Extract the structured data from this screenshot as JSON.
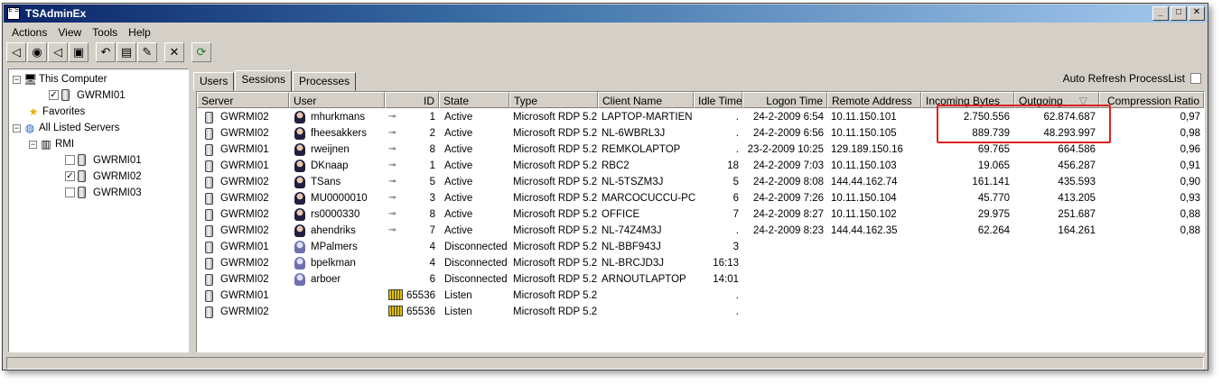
{
  "window": {
    "title": "TSAdminEx",
    "icon_text": "E S",
    "controls": {
      "minimize": "_",
      "maximize": "□",
      "close": "✕"
    }
  },
  "menu": [
    "Actions",
    "View",
    "Tools",
    "Help"
  ],
  "toolbar": [
    {
      "name": "connect-icon",
      "glyph": "◁"
    },
    {
      "name": "send-message-icon",
      "glyph": "◉"
    },
    {
      "name": "disconnect-icon",
      "glyph": "◁"
    },
    {
      "name": "remote-control-icon",
      "glyph": "▣"
    },
    {
      "name": "logoff-icon",
      "glyph": "↶"
    },
    {
      "name": "reset-icon",
      "glyph": "▤"
    },
    {
      "name": "status-icon",
      "glyph": "✎"
    },
    {
      "name": "delete-icon",
      "glyph": "✕"
    },
    {
      "name": "refresh-icon",
      "glyph": "⟳"
    }
  ],
  "tree": {
    "this_computer": "This Computer",
    "this_computer_server": "GWRMI01",
    "favorites": "Favorites",
    "all_listed": "All Listed Servers",
    "domain": "RMI",
    "servers": [
      "GWRMI01",
      "GWRMI02",
      "GWRMI03"
    ]
  },
  "tabs": [
    "Users",
    "Sessions",
    "Processes"
  ],
  "active_tab": "Sessions",
  "auto_refresh_label": "Auto Refresh ProcessList",
  "columns": [
    "Server",
    "User",
    "ID",
    "State",
    "Type",
    "Client Name",
    "Idle Time",
    "Logon Time",
    "Remote Address",
    "Incoming Bytes",
    "Outgoing",
    "Compression Ratio"
  ],
  "rows": [
    {
      "server": "GWRMI02",
      "user": "mhurkmans",
      "kind": "active",
      "id": "1",
      "state": "Active",
      "type": "Microsoft RDP 5.2",
      "client": "LAPTOP-MARTIEN",
      "idle": ".",
      "logon": "24-2-2009 6:54",
      "remote": "10.11.150.101",
      "in": "2.750.556",
      "out": "62.874.687",
      "ratio": "0,97"
    },
    {
      "server": "GWRMI02",
      "user": "fheesakkers",
      "kind": "active",
      "id": "2",
      "state": "Active",
      "type": "Microsoft RDP 5.2",
      "client": "NL-6WBRL3J",
      "idle": ".",
      "logon": "24-2-2009 6:56",
      "remote": "10.11.150.105",
      "in": "889.739",
      "out": "48.293.997",
      "ratio": "0,98"
    },
    {
      "server": "GWRMI01",
      "user": "rweijnen",
      "kind": "active",
      "id": "8",
      "state": "Active",
      "type": "Microsoft RDP 5.2",
      "client": "REMKOLAPTOP",
      "idle": ".",
      "logon": "23-2-2009 10:25",
      "remote": "129.189.150.16",
      "in": "69.765",
      "out": "664.586",
      "ratio": "0,96"
    },
    {
      "server": "GWRMI01",
      "user": "DKnaap",
      "kind": "active",
      "id": "1",
      "state": "Active",
      "type": "Microsoft RDP 5.2",
      "client": "RBC2",
      "idle": "18",
      "logon": "24-2-2009 7:03",
      "remote": "10.11.150.103",
      "in": "19.065",
      "out": "456.287",
      "ratio": "0,91"
    },
    {
      "server": "GWRMI02",
      "user": "TSans",
      "kind": "active",
      "id": "5",
      "state": "Active",
      "type": "Microsoft RDP 5.2",
      "client": "NL-5TSZM3J",
      "idle": "5",
      "logon": "24-2-2009 8:08",
      "remote": "144.44.162.74",
      "in": "161.141",
      "out": "435.593",
      "ratio": "0,90"
    },
    {
      "server": "GWRMI02",
      "user": "MU0000010",
      "kind": "active",
      "id": "3",
      "state": "Active",
      "type": "Microsoft RDP 5.2",
      "client": "MARCOCUCCU-PC",
      "idle": "6",
      "logon": "24-2-2009 7:26",
      "remote": "10.11.150.104",
      "in": "45.770",
      "out": "413.205",
      "ratio": "0,93"
    },
    {
      "server": "GWRMI02",
      "user": "rs0000330",
      "kind": "active",
      "id": "8",
      "state": "Active",
      "type": "Microsoft RDP 5.2",
      "client": "OFFICE",
      "idle": "7",
      "logon": "24-2-2009 8:27",
      "remote": "10.11.150.102",
      "in": "29.975",
      "out": "251.687",
      "ratio": "0,88"
    },
    {
      "server": "GWRMI02",
      "user": "ahendriks",
      "kind": "active",
      "id": "7",
      "state": "Active",
      "type": "Microsoft RDP 5.2",
      "client": "NL-74Z4M3J",
      "idle": ".",
      "logon": "24-2-2009 8:23",
      "remote": "144.44.162.35",
      "in": "62.264",
      "out": "164.261",
      "ratio": "0,88"
    },
    {
      "server": "GWRMI01",
      "user": "MPalmers",
      "kind": "disc",
      "id": "4",
      "state": "Disconnected",
      "type": "Microsoft RDP 5.2",
      "client": "NL-BBF943J",
      "idle": "3",
      "logon": "",
      "remote": "",
      "in": "",
      "out": "",
      "ratio": ""
    },
    {
      "server": "GWRMI02",
      "user": "bpelkman",
      "kind": "disc",
      "id": "4",
      "state": "Disconnected",
      "type": "Microsoft RDP 5.2",
      "client": "NL-BRCJD3J",
      "idle": "16:13",
      "logon": "",
      "remote": "",
      "in": "",
      "out": "",
      "ratio": ""
    },
    {
      "server": "GWRMI02",
      "user": "arboer",
      "kind": "disc",
      "id": "6",
      "state": "Disconnected",
      "type": "Microsoft RDP 5.2",
      "client": "ARNOUTLAPTOP",
      "idle": "14:01",
      "logon": "",
      "remote": "",
      "in": "",
      "out": "",
      "ratio": ""
    },
    {
      "server": "GWRMI01",
      "user": "",
      "kind": "listen",
      "id": "65536",
      "state": "Listen",
      "type": "Microsoft RDP 5.2",
      "client": "",
      "idle": ".",
      "logon": "",
      "remote": "",
      "in": "",
      "out": "",
      "ratio": ""
    },
    {
      "server": "GWRMI02",
      "user": "",
      "kind": "listen",
      "id": "65536",
      "state": "Listen",
      "type": "Microsoft RDP 5.2",
      "client": "",
      "idle": ".",
      "logon": "",
      "remote": "",
      "in": "",
      "out": "",
      "ratio": ""
    }
  ],
  "sort_indicator": "▽",
  "highlight_color": "#e02020"
}
